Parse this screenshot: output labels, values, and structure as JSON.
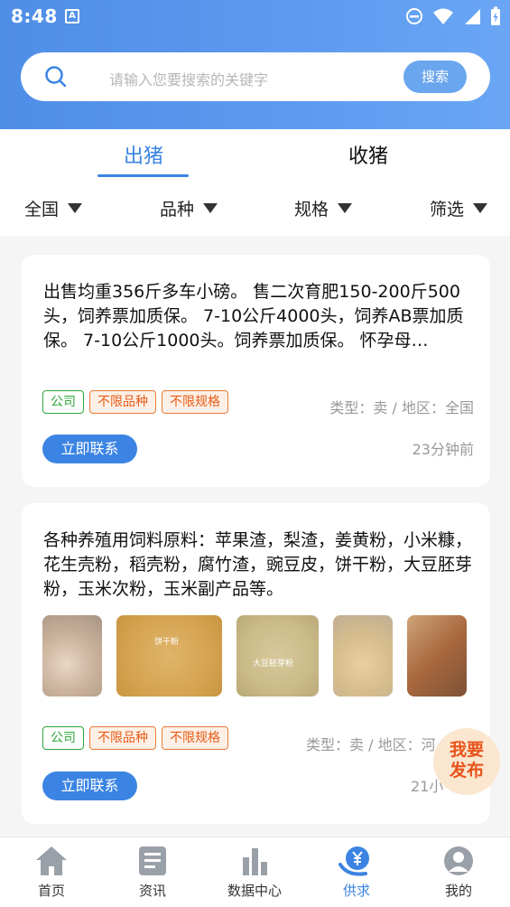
{
  "status_bar": {
    "time": "8:48",
    "notif_icon": "A"
  },
  "search": {
    "placeholder": "请输入您要搜索的关键字",
    "button": "搜索"
  },
  "tabs": [
    {
      "label": "出猪",
      "active": true
    },
    {
      "label": "收猪",
      "active": false
    }
  ],
  "filters": [
    {
      "label": "全国"
    },
    {
      "label": "品种"
    },
    {
      "label": "规格"
    },
    {
      "label": "筛选"
    }
  ],
  "listings": [
    {
      "description": "出售均重356斤多车小磅。 售二次育肥150-200斤500头，饲养票加质保。 7-10公斤4000头，饲养AB票加质保。 7-10公斤1000头。饲养票加质保。 怀孕母…",
      "tags": [
        "公司",
        "不限品种",
        "不限规格"
      ],
      "meta": "类型：卖 / 地区：全国",
      "time": "23分钟前",
      "contact": "立即联系"
    },
    {
      "description": "各种养殖用饲料原料：苹果渣，梨渣，姜黄粉，小米糠，花生壳粉，稻壳粉，腐竹渣，豌豆皮，饼干粉，大豆胚芽粉，玉米次粉，玉米副产品等。",
      "images": [
        {
          "caption": "",
          "color": "#c9b7a6"
        },
        {
          "caption": "饼干粉",
          "color": "#d9ab5c"
        },
        {
          "caption": "大豆胚芽粉",
          "color": "#cdbd8e"
        },
        {
          "caption": "",
          "color": "#dcc498"
        },
        {
          "caption": "",
          "color": "#b07650"
        }
      ],
      "tags": [
        "公司",
        "不限品种",
        "不限规格"
      ],
      "meta": "类型：卖 / 地区：河",
      "time": "21小",
      "contact": "立即联系"
    }
  ],
  "fab": {
    "line1": "我要",
    "line2": "发布"
  },
  "bottom_nav": [
    {
      "label": "首页",
      "icon": "home-icon",
      "active": false
    },
    {
      "label": "资讯",
      "icon": "news-icon",
      "active": false
    },
    {
      "label": "数据中心",
      "icon": "chart-icon",
      "active": false
    },
    {
      "label": "供求",
      "icon": "yuan-icon",
      "active": true
    },
    {
      "label": "我的",
      "icon": "user-icon",
      "active": false
    }
  ],
  "colors": {
    "primary": "#3b84e3",
    "header": "#5d9bf0",
    "tag_green": "#2da63a",
    "tag_orange": "#e85a18",
    "fab_bg": "#fbe6cf"
  }
}
